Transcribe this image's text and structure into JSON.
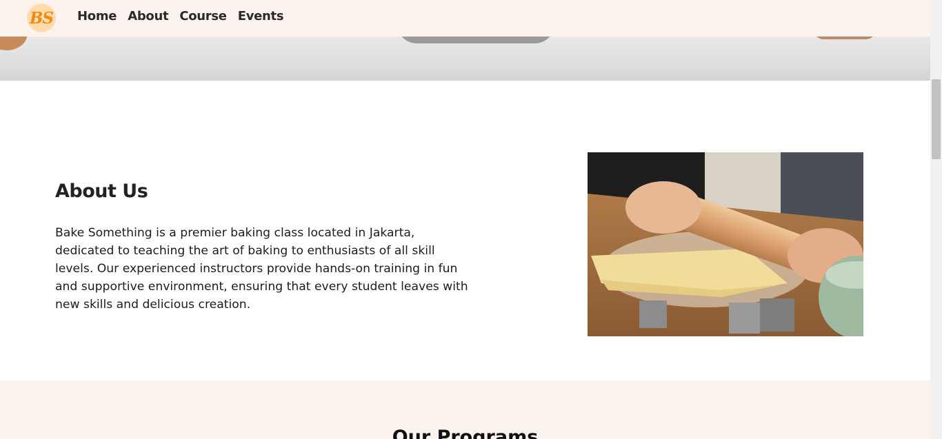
{
  "nav": {
    "logo_text": "BS",
    "links": [
      "Home",
      "About",
      "Course",
      "Events"
    ]
  },
  "about": {
    "heading": "About Us",
    "body": "Bake Something is a premier baking class located in Jakarta, dedicated to teaching the art of baking to enthusiasts of all skill levels. Our experienced instructors provide hands-on training in fun and supportive environment, ensuring that every student leaves with new skills and delicious creation.",
    "image_alt": "rolling-dough-photo"
  },
  "programs": {
    "heading": "Our Programs"
  },
  "colors": {
    "nav_bg": "#fdf3ee",
    "logo_accent": "#f08a14",
    "section_alt_bg": "#fdf3ee"
  }
}
